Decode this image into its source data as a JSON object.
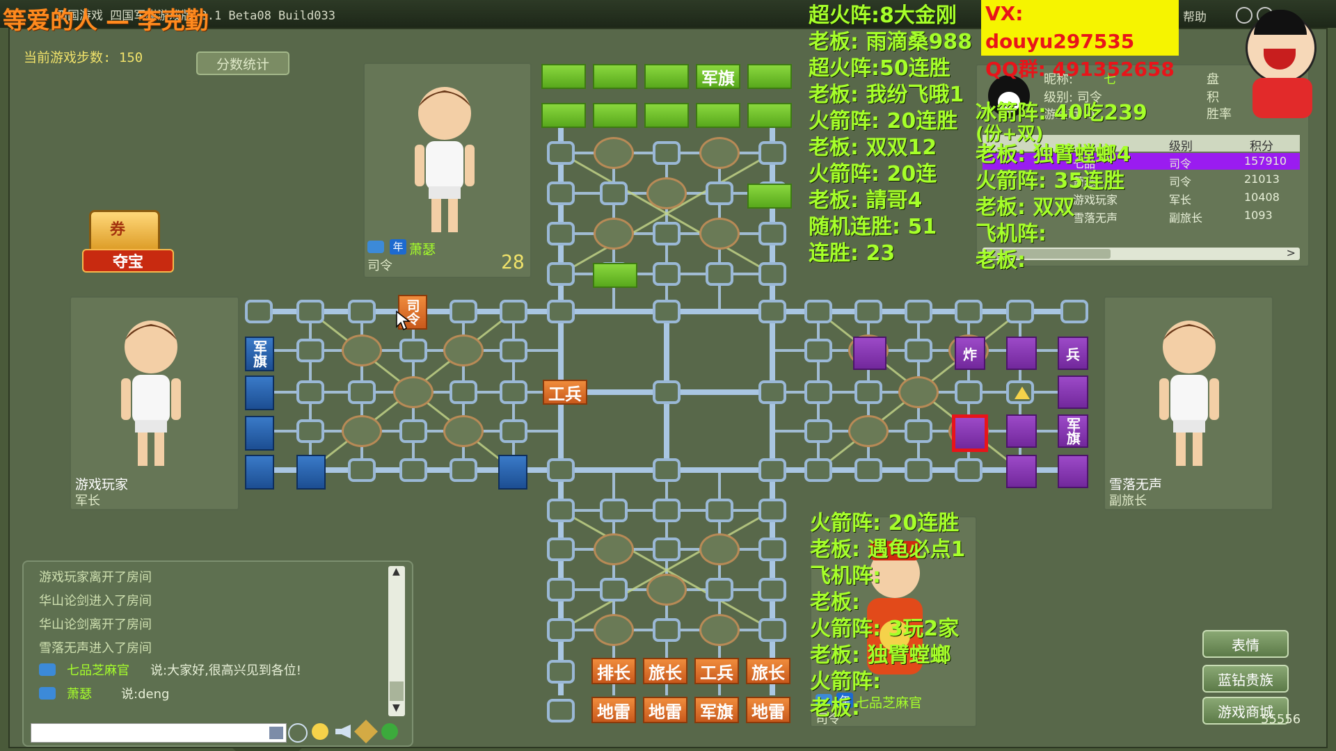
{
  "window": {
    "title_text": "四国游戏 四国军棋游戏版 2.1 Beta08 Build033",
    "help_label": "帮助"
  },
  "stream_overlay": {
    "top_left_banner": "等爱的人 — 李克勤",
    "vx": "VX: douyu297535",
    "qq": "QQ群: 491352658",
    "right_lines": [
      "超火阵:8大金刚",
      "老板: 雨滴桑988",
      "超火阵:50连胜",
      "老板: 我纷飞哦1",
      "火箭阵: 20连胜",
      "老板: 双双12",
      "火箭阵: 20连",
      "老板: 請哥4",
      "随机连胜: 51",
      "连胜: 23"
    ],
    "mid_lines": [
      "冰箭阵: 40吃239",
      "(份+双)",
      "老板: 独臂螳螂4",
      "火箭阵: 35连胜",
      "老板: 双双",
      "飞机阵:",
      "老板:"
    ],
    "bottom_lines": [
      "火箭阵: 20连胜",
      "老板: 遇龟必点1",
      "飞机阵:",
      "老板:",
      "火箭阵: 3玩2家",
      "老板: 独臂螳螂",
      "火箭阵:",
      "老板:"
    ],
    "watermark": "55556"
  },
  "game": {
    "steps_label": "当前游戏步数:",
    "steps_value": "150",
    "score_button": "分数统计",
    "treasure_label": "夺宝",
    "treasure_ticket": "券"
  },
  "players": {
    "top": {
      "name": "萧瑟",
      "rank": "司令",
      "timer": "28",
      "badge_year": "年"
    },
    "left": {
      "name": "游戏玩家",
      "rank": "军长"
    },
    "right": {
      "name": "雪落无声",
      "rank": "副旅长"
    },
    "bottom": {
      "name": "七品芝麻官",
      "rank": "司令",
      "badge_year": "年"
    }
  },
  "info_panel": {
    "nickname_label": "昵称:",
    "nickname_value": "七",
    "level_label": "级别: 司令",
    "coins_label": "游戏币: 0",
    "right_labels": [
      "盘",
      "积",
      "胜率"
    ],
    "table_headers": [
      "级别",
      "积分"
    ],
    "rows": [
      {
        "name": "七品",
        "rank": "司令",
        "score": "157910"
      },
      {
        "name": "萧瑟",
        "rank": "司令",
        "score": "21013"
      },
      {
        "name": "游戏玩家",
        "rank": "军长",
        "score": "10408"
      },
      {
        "name": "雪落无声",
        "rank": "副旅长",
        "score": "1093"
      }
    ]
  },
  "pieces": {
    "top_flag": "军旗",
    "left_flag": "军旗",
    "right_flag": "军旗",
    "right_bomb": "炸",
    "right_soldier": "兵",
    "orange_moving": "司令",
    "orange_center": "工兵",
    "bottom_row1": [
      "排长",
      "旅长",
      "工兵",
      "旅长"
    ],
    "bottom_row2": [
      "地雷",
      "地雷",
      "军旗",
      "地雷"
    ]
  },
  "chat": {
    "lines": [
      "游戏玩家离开了房间",
      "华山论剑进入了房间",
      "华山论剑离开了房间",
      "雪落无声进入了房间"
    ],
    "msg1_name": "七品芝麻官",
    "msg1_text": "说:大家好,很高兴见到各位!",
    "msg2_name": "萧瑟",
    "msg2_text": "说:deng"
  },
  "side_buttons": [
    "表情",
    "蓝钻贵族",
    "游戏商城"
  ],
  "colors": {
    "accent_green": "#a6ff2a",
    "accent_orange": "#ff8a1e",
    "banner_yellow": "#f6f400",
    "highlight_purple": "#9a1cf0"
  }
}
